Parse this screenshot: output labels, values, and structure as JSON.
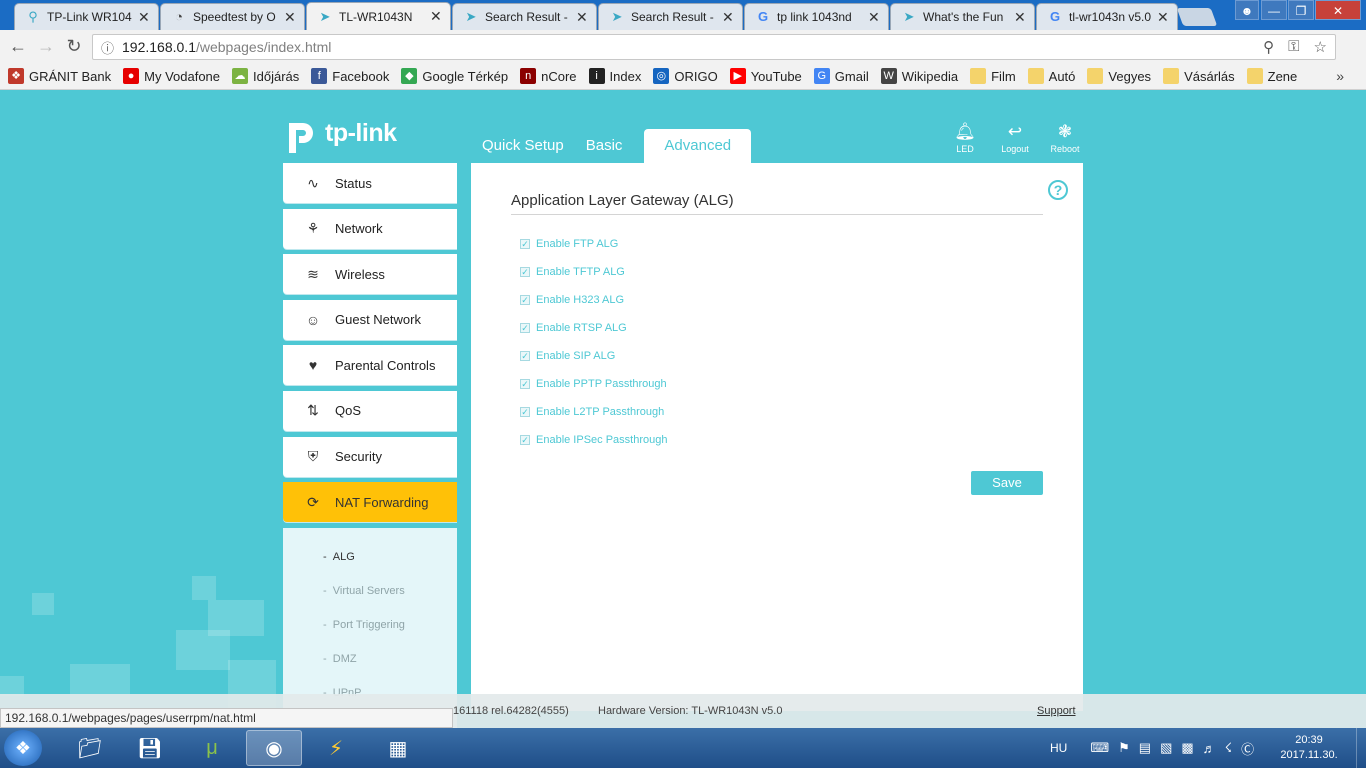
{
  "browser": {
    "tabs": [
      {
        "title": "TP-Link WR104",
        "icon": "search-icon"
      },
      {
        "title": "Speedtest by O",
        "icon": "speedometer-icon"
      },
      {
        "title": "TL-WR1043N",
        "icon": "tplink-icon"
      },
      {
        "title": "Search Result -",
        "icon": "tplink-icon"
      },
      {
        "title": "Search Result -",
        "icon": "tplink-icon"
      },
      {
        "title": "tp link 1043nd",
        "icon": "google-icon"
      },
      {
        "title": "What's the Fun",
        "icon": "tplink-icon"
      },
      {
        "title": "tl-wr1043n v5.0",
        "icon": "google-icon"
      }
    ],
    "url_host": "192.168.0.1",
    "url_path": "/webpages/index.html",
    "bookmarks": [
      {
        "label": "GRÁNIT Bank",
        "color": "#c0392b"
      },
      {
        "label": "My Vodafone",
        "color": "#e60000"
      },
      {
        "label": "Időjárás",
        "color": "#7cb342"
      },
      {
        "label": "Facebook",
        "color": "#3b5998"
      },
      {
        "label": "Google Térkép",
        "color": "#34a853"
      },
      {
        "label": "nCore",
        "color": "#8b0000"
      },
      {
        "label": "Index",
        "color": "#222222"
      },
      {
        "label": "ORIGO",
        "color": "#1565c0"
      },
      {
        "label": "YouTube",
        "color": "#ff0000"
      },
      {
        "label": "Gmail",
        "color": "#4285f4"
      },
      {
        "label": "Wikipedia",
        "color": "#444444"
      },
      {
        "label": "Film",
        "color": "#f4d36b"
      },
      {
        "label": "Autó",
        "color": "#f4d36b"
      },
      {
        "label": "Vegyes",
        "color": "#f4d36b"
      },
      {
        "label": "Vásárlás",
        "color": "#f4d36b"
      },
      {
        "label": "Zene",
        "color": "#f4d36b"
      }
    ],
    "status_url": "192.168.0.1/webpages/pages/userrpm/nat.html"
  },
  "router": {
    "brand": "tp-link",
    "accent": "#4ec8d4",
    "top_nav": [
      "Quick Setup",
      "Basic",
      "Advanced"
    ],
    "tools": [
      {
        "label": "LED",
        "icon": "bell-icon"
      },
      {
        "label": "Logout",
        "icon": "logout-icon"
      },
      {
        "label": "Reboot",
        "icon": "reboot-icon"
      }
    ],
    "sidebar": [
      {
        "label": "Status",
        "icon": "pulse-icon"
      },
      {
        "label": "Network",
        "icon": "network-icon"
      },
      {
        "label": "Wireless",
        "icon": "wifi-icon"
      },
      {
        "label": "Guest Network",
        "icon": "guest-icon"
      },
      {
        "label": "Parental Controls",
        "icon": "heart-icon"
      },
      {
        "label": "QoS",
        "icon": "updown-arrows-icon"
      },
      {
        "label": "Security",
        "icon": "shield-icon"
      },
      {
        "label": "NAT Forwarding",
        "icon": "nat-icon"
      }
    ],
    "submenu": [
      {
        "label": "ALG"
      },
      {
        "label": "Virtual Servers"
      },
      {
        "label": "Port Triggering"
      },
      {
        "label": "DMZ"
      },
      {
        "label": "UPnP"
      }
    ],
    "page_title": "Application Layer Gateway (ALG)",
    "options": [
      {
        "label": "Enable FTP ALG",
        "checked": true
      },
      {
        "label": "Enable TFTP ALG",
        "checked": true
      },
      {
        "label": "Enable H323 ALG",
        "checked": true
      },
      {
        "label": "Enable RTSP ALG",
        "checked": true
      },
      {
        "label": "Enable SIP ALG",
        "checked": true
      },
      {
        "label": "Enable PPTP Passthrough",
        "checked": true
      },
      {
        "label": "Enable L2TP Passthrough",
        "checked": true
      },
      {
        "label": "Enable IPSec Passthrough",
        "checked": true
      }
    ],
    "save_label": "Save",
    "firmware_fragment": "161118 rel.64282(4555)",
    "hardware_version": "Hardware Version: TL-WR1043N v5.0",
    "support_label": "Support"
  },
  "taskbar": {
    "language": "HU",
    "time": "20:39",
    "date": "2017.11.30."
  }
}
